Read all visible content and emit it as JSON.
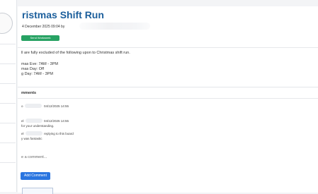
{
  "post": {
    "title": "ristmas Shift Run",
    "meta": "4 December 2025 09:04 by",
    "badge": "Send Workweek"
  },
  "body": {
    "intro": "ll are fully excluded of the following upon to Christmas shift run.",
    "lines": [
      "mas Eve: 7AM - 3PM",
      "mas Day: Off",
      "g Day: 7AM - 3PM"
    ]
  },
  "comments": {
    "heading": "mments",
    "items": [
      {
        "name": "o",
        "meta": "04/12/2025 14:55",
        "text": ""
      },
      {
        "name": "el",
        "meta": "04/12/2025 14:55",
        "text": "for your understanding."
      },
      {
        "name": "el",
        "meta": "replying to this board",
        "text": "y was fantastic"
      }
    ],
    "input_placeholder": "e a comment...",
    "add_button_label": "Add Comment"
  }
}
